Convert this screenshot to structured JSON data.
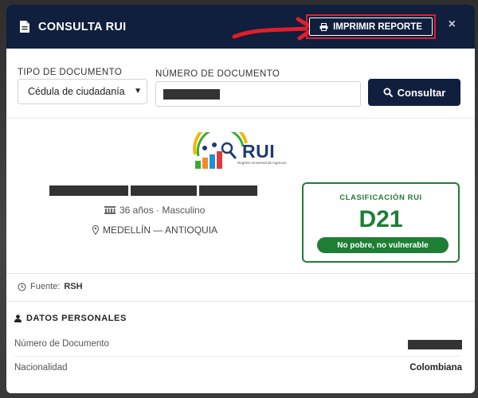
{
  "header": {
    "title": "CONSULTA RUI",
    "print_label": "IMPRIMIR REPORTE",
    "close_label": "×"
  },
  "form": {
    "tipo_label": "TIPO DE DOCUMENTO",
    "numero_label": "NÚMERO DE DOCUMENTO",
    "tipo_selected": "Cédula de ciudadanía",
    "numero_value": "",
    "consultar_label": "Consultar"
  },
  "logo": {
    "text": "RUI",
    "subtitle": "Registro Universal de Ingresos"
  },
  "person": {
    "age_gender": "36 años · Masculino",
    "location": "MEDELLÍN — ANTIOQUIA"
  },
  "classification": {
    "label": "CLASIFICACIÓN RUI",
    "code": "D21",
    "badge": "No pobre, no vulnerable"
  },
  "source": {
    "label": "Fuente:",
    "value": "RSH"
  },
  "personal": {
    "title": "DATOS PERSONALES",
    "rows": [
      {
        "label": "Número de Documento",
        "value": ""
      },
      {
        "label": "Nacionalidad",
        "value": "Colombiana"
      }
    ]
  },
  "colors": {
    "navy": "#0f1f3d",
    "green": "#1e7e34",
    "highlight_red": "#e11d2a"
  },
  "icons": {
    "title": "document-icon",
    "print": "printer-icon",
    "search": "search-icon",
    "age": "people-icon",
    "location": "map-marker-icon",
    "source": "clock-icon",
    "personal": "user-icon"
  }
}
